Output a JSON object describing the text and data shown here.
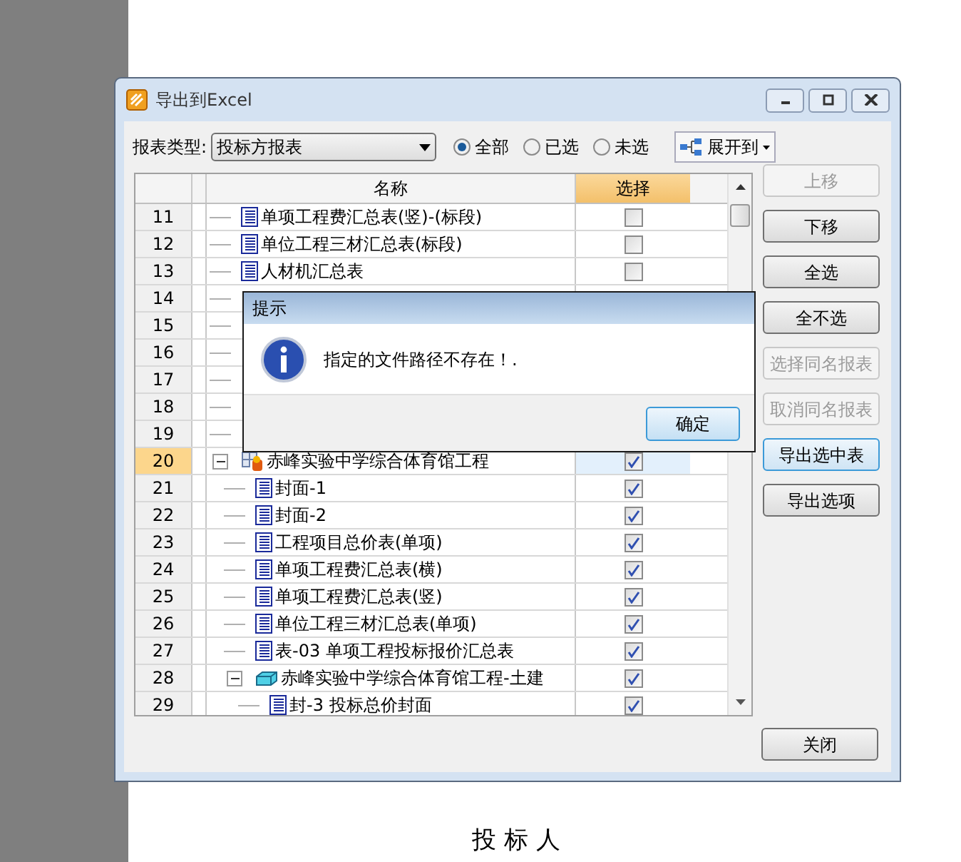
{
  "document": {
    "text": "投 标 人"
  },
  "window": {
    "title": "导出到Excel"
  },
  "toolbar": {
    "report_type_label": "报表类型:",
    "report_type_value": "投标方报表",
    "filters": [
      {
        "label": "全部",
        "selected": true
      },
      {
        "label": "已选",
        "selected": false
      },
      {
        "label": "未选",
        "selected": false
      }
    ],
    "expand_button": "展开到"
  },
  "table": {
    "columns": [
      "名称",
      "选择"
    ],
    "rows": [
      {
        "number": "11",
        "name": "单项工程费汇总表(竖)-(标段)",
        "kind": "report",
        "checked": false,
        "selected": false
      },
      {
        "number": "12",
        "name": "单位工程三材汇总表(标段)",
        "kind": "report",
        "checked": false,
        "selected": false
      },
      {
        "number": "13",
        "name": "人材机汇总表",
        "kind": "report",
        "checked": false,
        "selected": false
      },
      {
        "number": "14"
      },
      {
        "number": "15"
      },
      {
        "number": "16"
      },
      {
        "number": "17"
      },
      {
        "number": "18"
      },
      {
        "number": "19"
      },
      {
        "number": "20",
        "name": "赤峰实验中学综合体育馆工程",
        "kind": "project",
        "checked": true,
        "selected": true,
        "expanded": true,
        "children": [
          {
            "number": "21",
            "name": "封面-1",
            "kind": "report",
            "checked": true,
            "selected": false
          },
          {
            "number": "22",
            "name": "封面-2",
            "kind": "report",
            "checked": true,
            "selected": false
          },
          {
            "number": "23",
            "name": "工程项目总价表(单项)",
            "kind": "report",
            "checked": true,
            "selected": false
          },
          {
            "number": "24",
            "name": "单项工程费汇总表(横)",
            "kind": "report",
            "checked": true,
            "selected": false
          },
          {
            "number": "25",
            "name": "单项工程费汇总表(竖)",
            "kind": "report",
            "checked": true,
            "selected": false
          },
          {
            "number": "26",
            "name": "单位工程三材汇总表(单项)",
            "kind": "report",
            "checked": true,
            "selected": false
          },
          {
            "number": "27",
            "name": "表-03 单项工程投标报价汇总表",
            "kind": "report",
            "checked": true,
            "selected": false
          },
          {
            "number": "28",
            "name": "赤峰实验中学综合体育馆工程-土建",
            "kind": "unit",
            "checked": true,
            "selected": false,
            "expanded": true,
            "children": [
              {
                "number": "29",
                "name": "封-3 投标总价封面",
                "kind": "report",
                "checked": true,
                "selected": false
              }
            ]
          }
        ]
      }
    ]
  },
  "side_buttons": [
    {
      "label": "上移",
      "disabled": true,
      "focused": false
    },
    {
      "label": "下移",
      "disabled": false,
      "focused": false
    },
    {
      "label": "全选",
      "disabled": false,
      "focused": false
    },
    {
      "label": "全不选",
      "disabled": false,
      "focused": false
    },
    {
      "label": "选择同名报表",
      "disabled": true,
      "focused": false
    },
    {
      "label": "取消同名报表",
      "disabled": true,
      "focused": false
    },
    {
      "label": "导出选中表",
      "disabled": false,
      "focused": true
    },
    {
      "label": "导出选项",
      "disabled": false,
      "focused": false
    }
  ],
  "close_button": "关闭",
  "message_box": {
    "title": "提示",
    "message": "指定的文件路径不存在！.",
    "button": "确定"
  }
}
